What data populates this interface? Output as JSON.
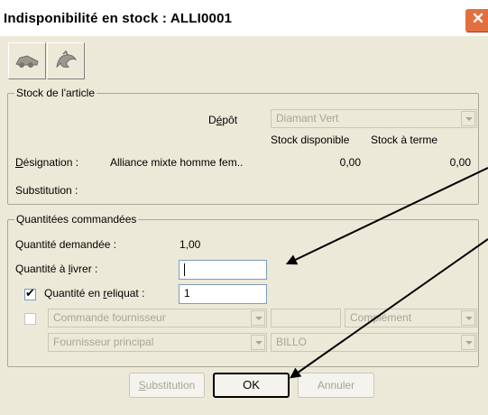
{
  "window": {
    "title": "Indisponibilité en stock : ALLI0001",
    "close_glyph": "✕",
    "accent_color": "#e2703f"
  },
  "toolbar": {
    "buttons": [
      {
        "icon": "gray-car-icon"
      },
      {
        "icon": "gray-swirl-icon"
      }
    ]
  },
  "stock_group": {
    "legend": "Stock de l'article",
    "depot_label_prefix": "D",
    "depot_label_underline": "é",
    "depot_label_suffix": "pôt",
    "depot_value": "Diamant Vert",
    "col_stock_disponible": "Stock disponible",
    "col_stock_a_terme": "Stock à terme",
    "designation_label_underline": "D",
    "designation_label_suffix": "ésignation :",
    "designation_value": "Alliance mixte homme fem..",
    "stock_disponible_value": "0,00",
    "stock_a_terme_value": "0,00",
    "substitution_label": "Substitution :"
  },
  "qty_group": {
    "legend": "Quantitées commandées",
    "demandee_label": "Quantité demandée :",
    "demandee_value": "1,00",
    "livrer_label_prefix": "Quantité à ",
    "livrer_label_underline": "l",
    "livrer_label_suffix": "ivrer :",
    "livrer_value": "",
    "reliquat_checked": true,
    "reliquat_check_glyph": "✔",
    "reliquat_label_prefix": "Quantité en ",
    "reliquat_label_underline": "r",
    "reliquat_label_suffix": "eliquat :",
    "reliquat_value": "1",
    "commande_checked": false,
    "commande_select": "Commande fournisseur",
    "complement_select": "Complément",
    "fournisseur_select": "Fournisseur principal",
    "billo_select": "BILLO"
  },
  "footer": {
    "substitution_underline": "S",
    "substitution_suffix": "ubstitution",
    "ok": "OK",
    "annuler": "Annuler"
  }
}
